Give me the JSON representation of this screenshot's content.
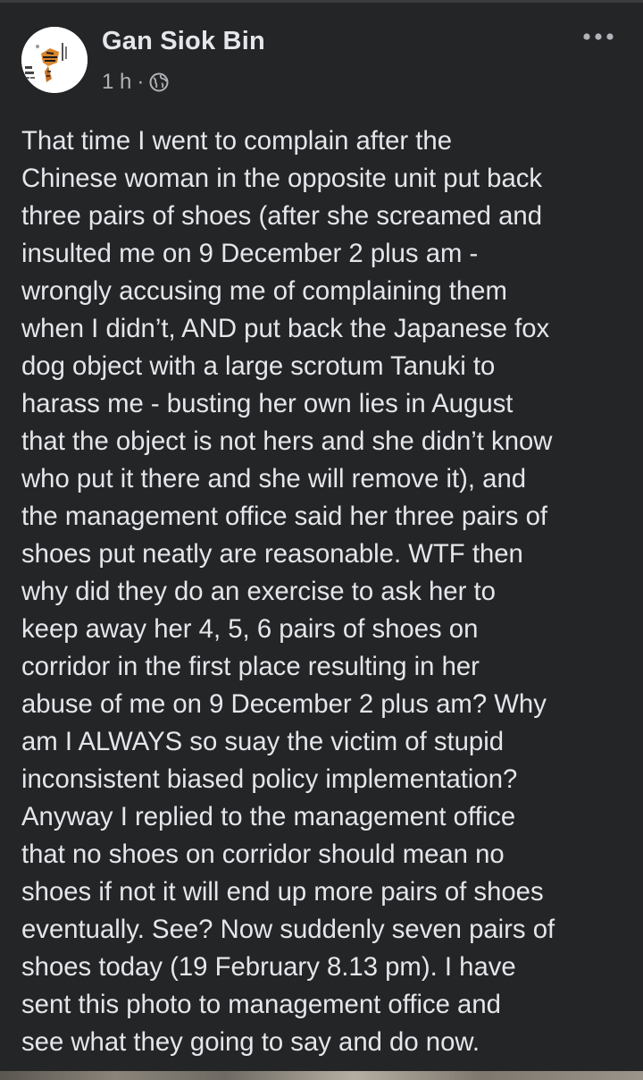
{
  "post": {
    "author": "Gan Siok Bin",
    "time": "1 h",
    "separator": "·",
    "privacy_icon": "globe-icon",
    "more_icon": "more-options-icon",
    "body": "That time I went to complain after the\nChinese woman in the opposite unit put back\nthree pairs of shoes (after she screamed and\ninsulted me on 9 December 2 plus am -\nwrongly accusing me of complaining them\nwhen I didn’t, AND put back the Japanese fox\ndog object with a large scrotum Tanuki to\nharass me - busting her own lies in August\nthat the object is not hers and she didn’t know\nwho put it there and she will remove it), and\nthe management office said her three pairs of\nshoes put neatly are reasonable. WTF then\nwhy did they do an exercise to ask her to\nkeep away her 4, 5, 6 pairs of shoes on\ncorridor in the first place resulting in her\nabuse of me on 9 December 2 plus am? Why\nam I ALWAYS so suay the victim of stupid\ninconsistent biased policy implementation?\nAnyway I replied to the management office\nthat no shoes on corridor should mean no\nshoes if not it will end up more pairs of shoes\neventually. See? Now suddenly seven pairs of\nshoes today (19 February 8.13 pm). I have\nsent this photo to management office and\nsee what they going to say and do now."
  },
  "colors": {
    "background": "#242526",
    "primary_text": "#e4e6eb",
    "secondary_text": "#b0b3b8"
  }
}
